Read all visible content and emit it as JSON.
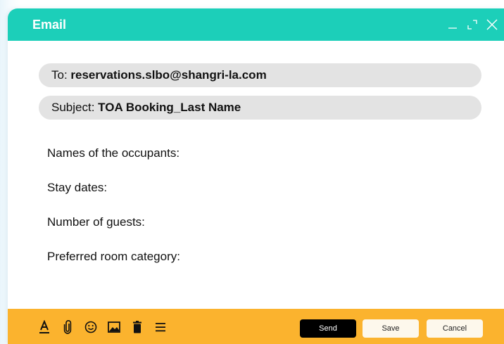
{
  "window": {
    "title": "Email",
    "controls": [
      "minimize-icon",
      "maximize-icon",
      "close-icon"
    ]
  },
  "compose": {
    "to_label": "To:",
    "to_value": "reservations.slbo@shangri-la.com",
    "subject_label": "Subject:",
    "subject_value": "TOA Booking_Last Name"
  },
  "body": {
    "lines": [
      "Names of the occupants:",
      "Stay dates:",
      "Number of guests:",
      "Preferred room category:"
    ]
  },
  "toolbar": {
    "tools": [
      "text-format-icon",
      "attachment-icon",
      "emoji-icon",
      "image-icon",
      "trash-icon",
      "menu-icon"
    ],
    "send_label": "Send",
    "save_label": "Save",
    "cancel_label": "Cancel"
  },
  "colors": {
    "titlebar": "#1ccfb9",
    "toolbar": "#fbb32e",
    "send_button": "#000000",
    "field_background": "#e3e3e3"
  }
}
